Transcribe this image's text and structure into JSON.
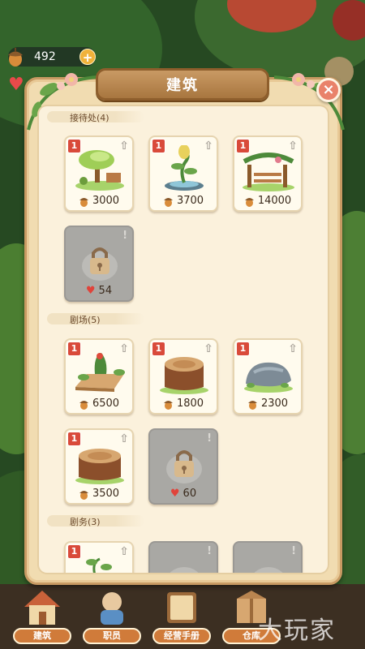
{
  "hud": {
    "acorns": "492",
    "plus_label": "+"
  },
  "panel": {
    "title": "建筑",
    "close_label": "×"
  },
  "sections": [
    {
      "name": "接待处(4)",
      "cards": [
        {
          "level": "1",
          "price": "3000",
          "currency": "acorn",
          "icon": "leaf-hut-icon"
        },
        {
          "level": "1",
          "price": "3700",
          "currency": "acorn",
          "icon": "sprout-fountain-icon"
        },
        {
          "level": "1",
          "price": "14000",
          "currency": "acorn",
          "icon": "vine-gate-icon"
        },
        {
          "locked": true,
          "price": "54",
          "currency": "heart",
          "icon": "lock-icon"
        }
      ]
    },
    {
      "name": "剧场(5)",
      "cards": [
        {
          "level": "1",
          "price": "6500",
          "currency": "acorn",
          "icon": "wood-stage-icon"
        },
        {
          "level": "1",
          "price": "1800",
          "currency": "acorn",
          "icon": "tree-stump-icon"
        },
        {
          "level": "1",
          "price": "2300",
          "currency": "acorn",
          "icon": "stone-icon"
        },
        {
          "level": "1",
          "price": "3500",
          "currency": "acorn",
          "icon": "tree-stump-icon"
        },
        {
          "locked": true,
          "price": "60",
          "currency": "heart",
          "icon": "lock-icon"
        }
      ]
    },
    {
      "name": "剧务(3)",
      "cards": [
        {
          "level": "1",
          "icon": "sprout-icon"
        },
        {
          "locked": true,
          "icon": "lock-icon"
        },
        {
          "locked": true,
          "icon": "lock-icon"
        }
      ]
    }
  ],
  "nav": [
    "建筑",
    "职员",
    "经营手册",
    "仓库"
  ],
  "watermark": "大玩家",
  "colors": {
    "level_badge": "#d94a3a",
    "panel_bg": "#fbf1dc",
    "nav_label": "#d07b3a"
  }
}
